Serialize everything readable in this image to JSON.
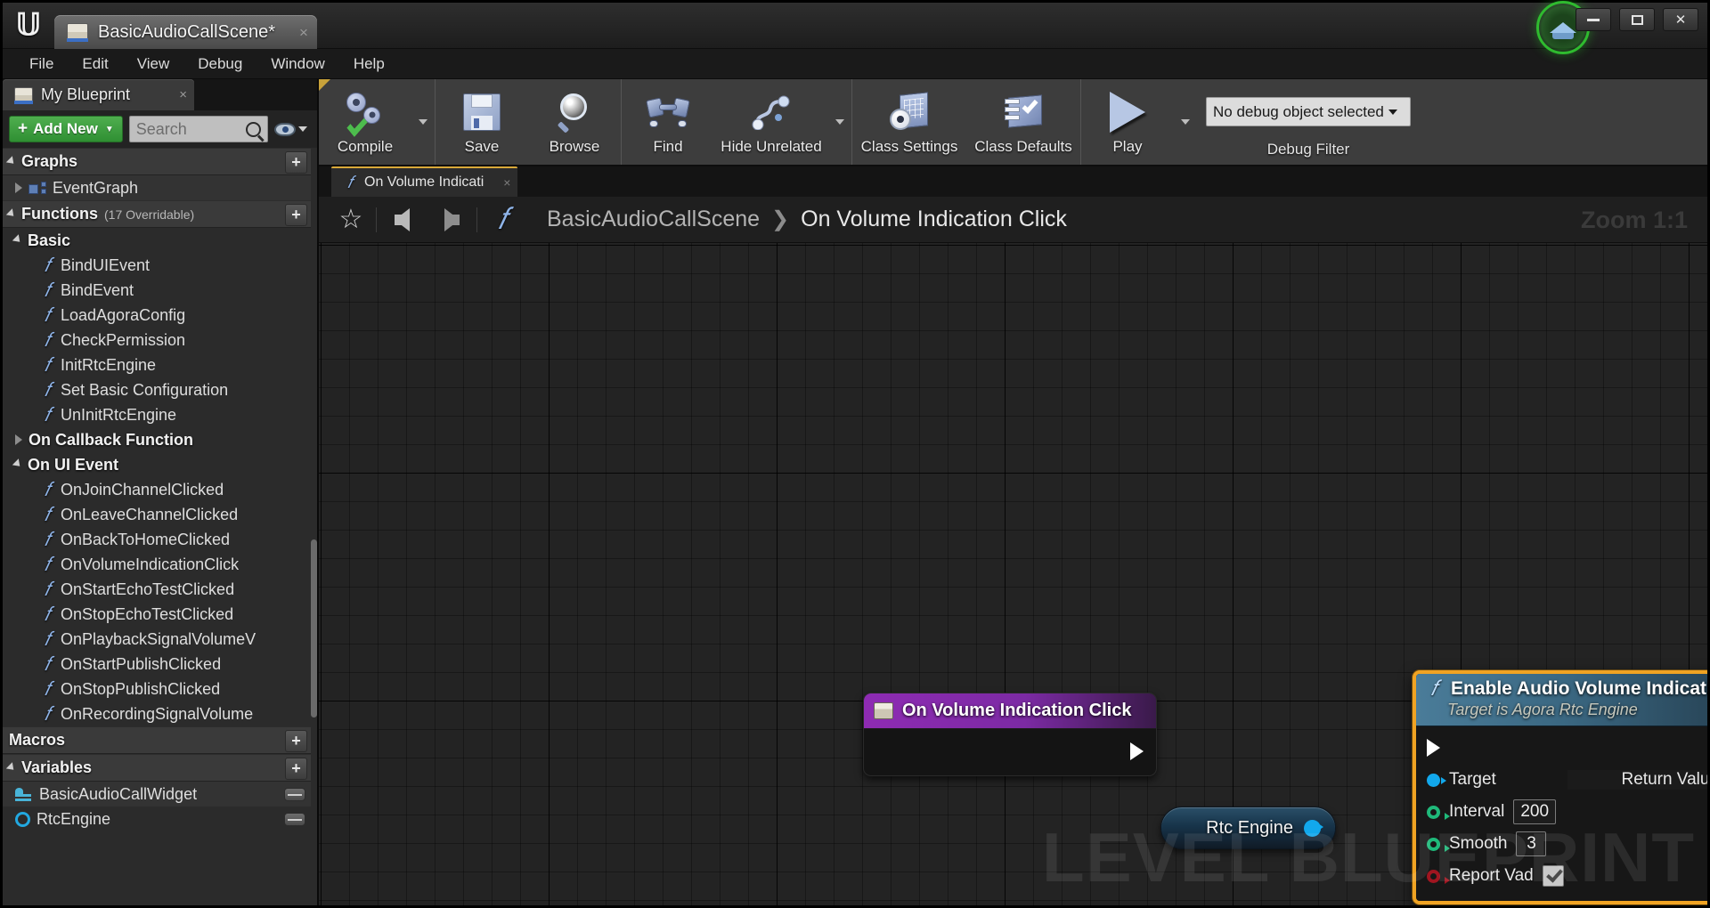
{
  "window": {
    "logo": "unreal-logo",
    "document_tab": "BasicAudioCallScene*",
    "tab_close": "×",
    "minimize": "minimize-icon",
    "maximize": "maximize-icon",
    "close": "✕",
    "tutorial_badge": "graduation-cap-icon"
  },
  "menu": {
    "items": [
      "File",
      "Edit",
      "View",
      "Debug",
      "Window",
      "Help"
    ]
  },
  "left_panel": {
    "tab_label": "My Blueprint",
    "tab_close": "×",
    "add_new_label": "Add New",
    "add_new_plus": "+",
    "add_new_caret": "▼",
    "search_placeholder": "Search",
    "search_value": "",
    "sections": [
      {
        "title": "Graphs",
        "subtitle": "",
        "expanded": true,
        "add_label": "+",
        "items": [
          {
            "label": "EventGraph",
            "icon": "graph-icon",
            "tri": "closed",
            "indent": 1,
            "band": true
          }
        ]
      },
      {
        "title": "Functions",
        "subtitle": "(17 Overridable)",
        "expanded": true,
        "add_label": "+",
        "items": [
          {
            "label": "Basic",
            "icon": "none",
            "tri": "open",
            "indent": 1,
            "bold": true
          },
          {
            "label": "BindUIEvent",
            "icon": "fx-icon",
            "indent": 2
          },
          {
            "label": "BindEvent",
            "icon": "fx-icon",
            "indent": 2
          },
          {
            "label": "LoadAgoraConfig",
            "icon": "fx-icon",
            "indent": 2
          },
          {
            "label": "CheckPermission",
            "icon": "fx-icon",
            "indent": 2
          },
          {
            "label": "InitRtcEngine",
            "icon": "fx-icon",
            "indent": 2
          },
          {
            "label": "Set Basic Configuration",
            "icon": "fx-icon",
            "indent": 2
          },
          {
            "label": "UnInitRtcEngine",
            "icon": "fx-icon",
            "indent": 2
          },
          {
            "label": "On Callback Function",
            "icon": "none",
            "tri": "closed",
            "indent": 1,
            "bold": true
          },
          {
            "label": "On UI Event",
            "icon": "none",
            "tri": "open",
            "indent": 1,
            "bold": true
          },
          {
            "label": "OnJoinChannelClicked",
            "icon": "fx-icon",
            "indent": 2
          },
          {
            "label": "OnLeaveChannelClicked",
            "icon": "fx-icon",
            "indent": 2
          },
          {
            "label": "OnBackToHomeClicked",
            "icon": "fx-icon",
            "indent": 2
          },
          {
            "label": "OnVolumeIndicationClick",
            "icon": "fx-icon",
            "indent": 2
          },
          {
            "label": "OnStartEchoTestClicked",
            "icon": "fx-icon",
            "indent": 2
          },
          {
            "label": "OnStopEchoTestClicked",
            "icon": "fx-icon",
            "indent": 2
          },
          {
            "label": "OnPlaybackSignalVolumeV",
            "icon": "fx-icon",
            "indent": 2
          },
          {
            "label": "OnStartPublishClicked",
            "icon": "fx-icon",
            "indent": 2
          },
          {
            "label": "OnStopPublishClicked",
            "icon": "fx-icon",
            "indent": 2
          },
          {
            "label": "OnRecordingSignalVolume",
            "icon": "fx-icon",
            "indent": 2
          }
        ]
      },
      {
        "title": "Macros",
        "subtitle": "",
        "expanded": false,
        "add_label": "+",
        "items": []
      },
      {
        "title": "Variables",
        "subtitle": "",
        "expanded": true,
        "add_label": "+",
        "items": [
          {
            "label": "BasicAudioCallWidget",
            "icon": "widget-icon",
            "indent": 1,
            "band": true,
            "pill": true
          },
          {
            "label": "RtcEngine",
            "icon": "obj-icon",
            "indent": 1,
            "pill": true
          }
        ]
      }
    ]
  },
  "toolbar": {
    "buttons": [
      {
        "label": "Compile",
        "icon": "compile-icon",
        "has_dropdown": true
      },
      {
        "label": "Save",
        "icon": "save-icon",
        "has_dropdown": false
      },
      {
        "label": "Browse",
        "icon": "browse-magnifier-icon",
        "has_dropdown": false
      },
      {
        "label": "Find",
        "icon": "find-binoculars-icon",
        "has_dropdown": false
      },
      {
        "label": "Hide Unrelated",
        "icon": "hide-unrelated-icon",
        "has_dropdown": true
      },
      {
        "label": "Class Settings",
        "icon": "class-settings-icon",
        "has_dropdown": false
      },
      {
        "label": "Class Defaults",
        "icon": "class-defaults-icon",
        "has_dropdown": false
      },
      {
        "label": "Play",
        "icon": "play-icon",
        "has_dropdown": true
      }
    ],
    "debug_object": "No debug object selected",
    "debug_object_caret": "▼",
    "debug_filter_label": "Debug Filter"
  },
  "graph_tabs": [
    {
      "label": "On Volume Indicati",
      "icon": "fx-icon",
      "close": "×",
      "active": true
    }
  ],
  "breadcrumb": {
    "favorite_icon": "star-icon",
    "back_icon": "arrow-left-icon",
    "forward_icon": "arrow-right-icon",
    "graph_icon": "fx-icon",
    "path": [
      "BasicAudioCallScene",
      "On Volume Indication Click"
    ],
    "chevron": "❯",
    "zoom_label": "Zoom 1:1"
  },
  "canvas": {
    "watermark": "LEVEL BLUEPRINT",
    "nodes": {
      "event": {
        "title": "On Volume Indication Click",
        "icon": "event-node-icon",
        "exec_out": "exec-out-pin"
      },
      "variable": {
        "title": "Rtc Engine",
        "out_pin": "object-out-pin"
      },
      "function": {
        "title": "Enable Audio Volume Indication",
        "subtitle": "Target is Agora Rtc Engine",
        "icon": "fx-icon",
        "border_color": "#f0a323",
        "exec_in": "exec-in-pin",
        "exec_out": "exec-out-pin",
        "inputs": [
          {
            "name": "Target",
            "pin": "filled-blue",
            "control": "none",
            "value": ""
          },
          {
            "name": "Interval",
            "pin": "hollow-green",
            "control": "textbox",
            "value": "200"
          },
          {
            "name": "Smooth",
            "pin": "hollow-green",
            "control": "textbox",
            "value": "3"
          },
          {
            "name": "Report Vad",
            "pin": "hollow-red",
            "control": "checkbox",
            "value": "checked"
          }
        ],
        "outputs": [
          {
            "name": "Return Value",
            "pin": "hollow-teal"
          }
        ]
      }
    }
  }
}
